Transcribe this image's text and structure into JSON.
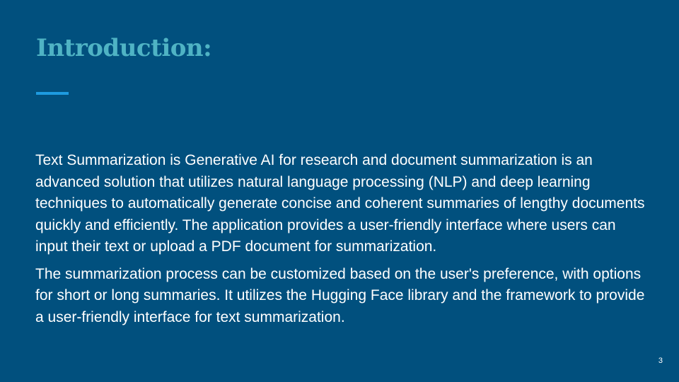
{
  "slide": {
    "title": "Introduction:",
    "paragraphs": [
      "Text Summarization is Generative AI for research and document summarization is an advanced solution that utilizes natural language processing (NLP) and deep learning techniques to automatically generate concise and coherent summaries of lengthy documents quickly and efficiently. The application provides a user-friendly interface where users can input their text or upload a PDF document for summarization.",
      "The summarization process can be customized based on the user's preference, with options for short or long summaries. It utilizes the Hugging Face library and the framework to provide a user-friendly interface for text summarization."
    ],
    "page_number": "3"
  },
  "colors": {
    "background": "#01507e",
    "title": "#4fb3c4",
    "accent": "#1e9be0",
    "text": "#ffffff"
  }
}
